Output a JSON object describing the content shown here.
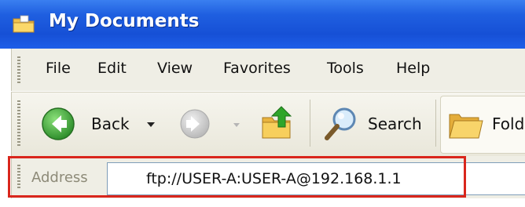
{
  "window": {
    "title": "My Documents"
  },
  "menu": {
    "items": [
      "File",
      "Edit",
      "View",
      "Favorites",
      "Tools",
      "Help"
    ]
  },
  "toolbar": {
    "back_label": "Back",
    "search_label": "Search",
    "folders_label": "Fold"
  },
  "address": {
    "label": "Address",
    "value": "ftp://USER-A:USER-A@192.168.1.1"
  },
  "colors": {
    "titlebar": "#1f5fe0",
    "highlight_border": "#d9261c",
    "back_button": "#3ba63a"
  },
  "icons": {
    "title": "folder-icon",
    "back": "back-arrow-icon",
    "forward": "forward-arrow-icon",
    "up": "up-folder-icon",
    "search": "search-icon",
    "folders": "folders-icon"
  }
}
